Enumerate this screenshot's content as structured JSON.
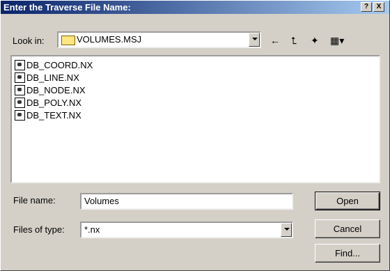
{
  "window": {
    "title": "Enter the Traverse File Name:",
    "help_label": "?",
    "close_label": "X"
  },
  "lookin": {
    "label": "Look in:",
    "value": "VOLUMES.MSJ"
  },
  "toolbar": {
    "back_icon": "←",
    "up_icon": "⮤",
    "newfolder_icon": "✦",
    "views_icon": "▦▾"
  },
  "files": [
    {
      "name": "DB_COORD.NX"
    },
    {
      "name": "DB_LINE.NX"
    },
    {
      "name": "DB_NODE.NX"
    },
    {
      "name": "DB_POLY.NX"
    },
    {
      "name": "DB_TEXT.NX"
    }
  ],
  "filename": {
    "label": "File name:",
    "value": "Volumes"
  },
  "filetype": {
    "label": "Files of type:",
    "value": "*.nx"
  },
  "buttons": {
    "open": "Open",
    "cancel": "Cancel",
    "find": "Find..."
  }
}
